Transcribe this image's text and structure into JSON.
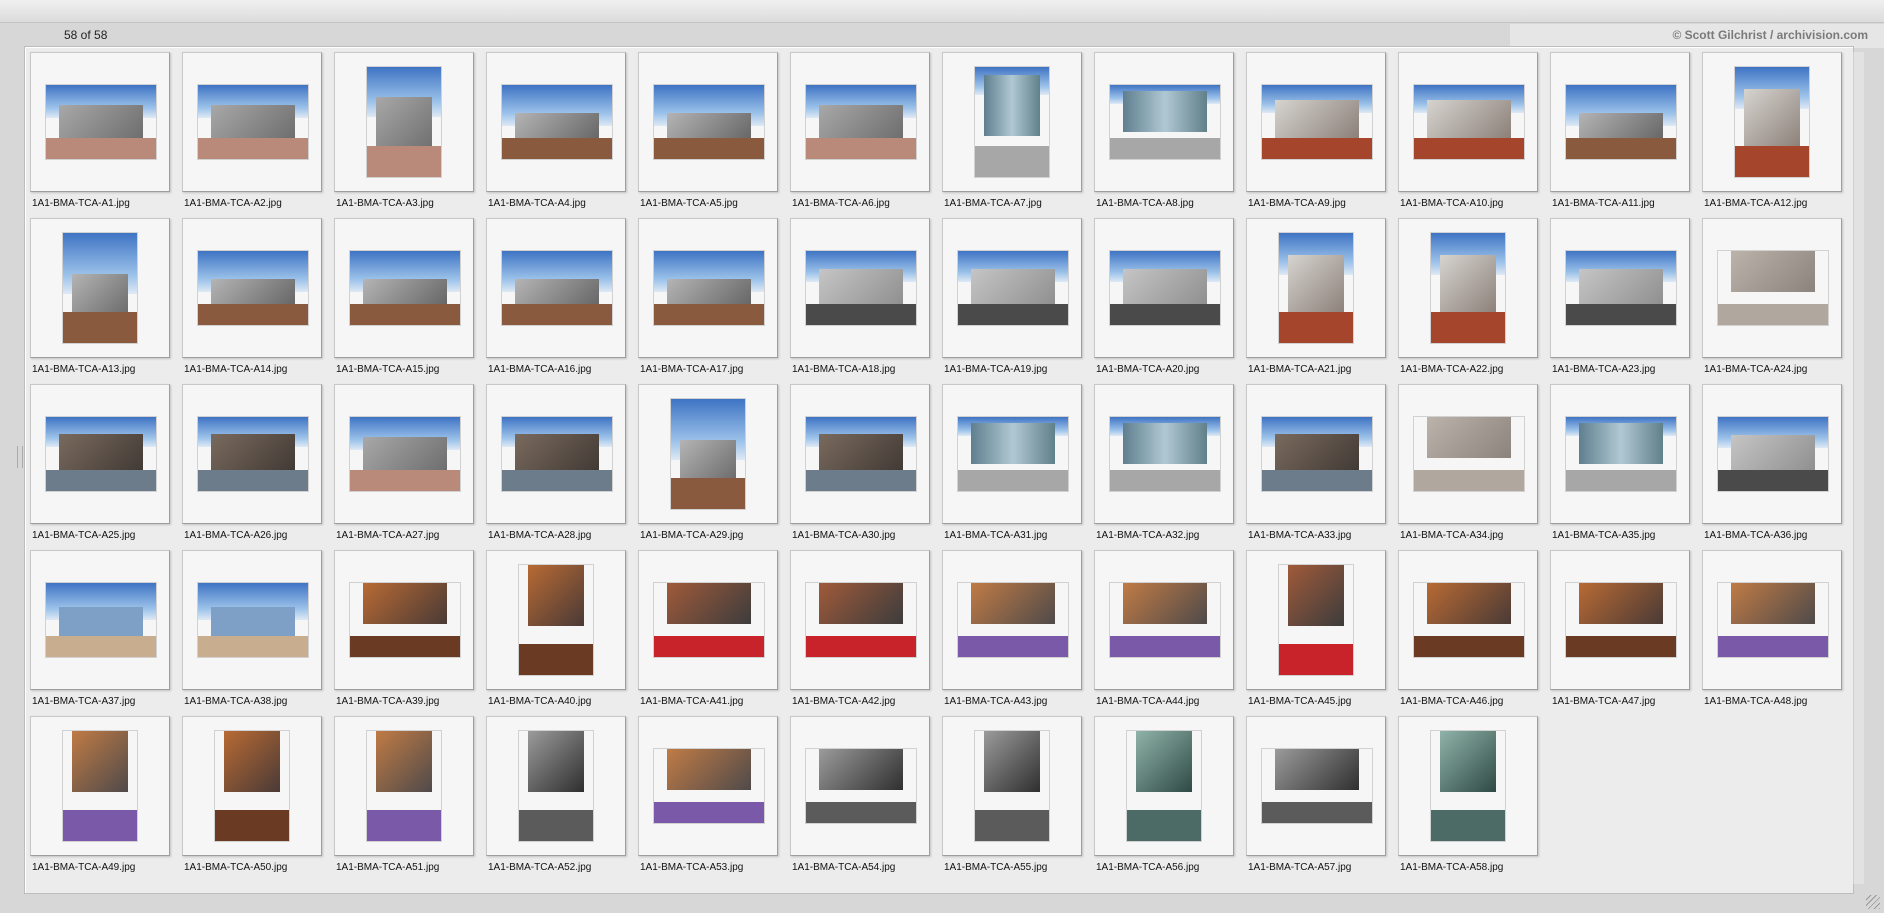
{
  "header": {
    "counter": "58 of 58",
    "copyright": "© Scott Gilchrist / archivision.com"
  },
  "thumbnails": [
    {
      "file": "1A1-BMA-TCA-A1.jpg",
      "orientation": "landscape",
      "scene": "exterior-plaza"
    },
    {
      "file": "1A1-BMA-TCA-A2.jpg",
      "orientation": "landscape",
      "scene": "exterior-plaza"
    },
    {
      "file": "1A1-BMA-TCA-A3.jpg",
      "orientation": "portrait",
      "scene": "exterior-plaza"
    },
    {
      "file": "1A1-BMA-TCA-A4.jpg",
      "orientation": "landscape",
      "scene": "exterior-sky"
    },
    {
      "file": "1A1-BMA-TCA-A5.jpg",
      "orientation": "landscape",
      "scene": "exterior-sky"
    },
    {
      "file": "1A1-BMA-TCA-A6.jpg",
      "orientation": "landscape",
      "scene": "exterior-plaza"
    },
    {
      "file": "1A1-BMA-TCA-A7.jpg",
      "orientation": "portrait",
      "scene": "glass"
    },
    {
      "file": "1A1-BMA-TCA-A8.jpg",
      "orientation": "landscape",
      "scene": "glass"
    },
    {
      "file": "1A1-BMA-TCA-A9.jpg",
      "orientation": "landscape",
      "scene": "exterior-desert"
    },
    {
      "file": "1A1-BMA-TCA-A10.jpg",
      "orientation": "landscape",
      "scene": "exterior-desert"
    },
    {
      "file": "1A1-BMA-TCA-A11.jpg",
      "orientation": "landscape",
      "scene": "exterior-sky"
    },
    {
      "file": "1A1-BMA-TCA-A12.jpg",
      "orientation": "portrait",
      "scene": "exterior-desert"
    },
    {
      "file": "1A1-BMA-TCA-A13.jpg",
      "orientation": "portrait",
      "scene": "exterior-sky"
    },
    {
      "file": "1A1-BMA-TCA-A14.jpg",
      "orientation": "landscape",
      "scene": "exterior-sky"
    },
    {
      "file": "1A1-BMA-TCA-A15.jpg",
      "orientation": "landscape",
      "scene": "exterior-sky"
    },
    {
      "file": "1A1-BMA-TCA-A16.jpg",
      "orientation": "landscape",
      "scene": "exterior-sky"
    },
    {
      "file": "1A1-BMA-TCA-A17.jpg",
      "orientation": "landscape",
      "scene": "exterior-sky"
    },
    {
      "file": "1A1-BMA-TCA-A18.jpg",
      "orientation": "landscape",
      "scene": "exterior-road"
    },
    {
      "file": "1A1-BMA-TCA-A19.jpg",
      "orientation": "landscape",
      "scene": "exterior-road"
    },
    {
      "file": "1A1-BMA-TCA-A20.jpg",
      "orientation": "landscape",
      "scene": "exterior-road"
    },
    {
      "file": "1A1-BMA-TCA-A21.jpg",
      "orientation": "portrait",
      "scene": "exterior-desert"
    },
    {
      "file": "1A1-BMA-TCA-A22.jpg",
      "orientation": "portrait",
      "scene": "exterior-desert"
    },
    {
      "file": "1A1-BMA-TCA-A23.jpg",
      "orientation": "landscape",
      "scene": "exterior-road"
    },
    {
      "file": "1A1-BMA-TCA-A24.jpg",
      "orientation": "landscape",
      "scene": "wall"
    },
    {
      "file": "1A1-BMA-TCA-A25.jpg",
      "orientation": "landscape",
      "scene": "water"
    },
    {
      "file": "1A1-BMA-TCA-A26.jpg",
      "orientation": "landscape",
      "scene": "water"
    },
    {
      "file": "1A1-BMA-TCA-A27.jpg",
      "orientation": "landscape",
      "scene": "exterior-plaza"
    },
    {
      "file": "1A1-BMA-TCA-A28.jpg",
      "orientation": "landscape",
      "scene": "water"
    },
    {
      "file": "1A1-BMA-TCA-A29.jpg",
      "orientation": "portrait",
      "scene": "exterior-sky"
    },
    {
      "file": "1A1-BMA-TCA-A30.jpg",
      "orientation": "landscape",
      "scene": "water"
    },
    {
      "file": "1A1-BMA-TCA-A31.jpg",
      "orientation": "landscape",
      "scene": "glass"
    },
    {
      "file": "1A1-BMA-TCA-A32.jpg",
      "orientation": "landscape",
      "scene": "glass"
    },
    {
      "file": "1A1-BMA-TCA-A33.jpg",
      "orientation": "landscape",
      "scene": "water"
    },
    {
      "file": "1A1-BMA-TCA-A34.jpg",
      "orientation": "landscape",
      "scene": "wall"
    },
    {
      "file": "1A1-BMA-TCA-A35.jpg",
      "orientation": "landscape",
      "scene": "glass"
    },
    {
      "file": "1A1-BMA-TCA-A36.jpg",
      "orientation": "landscape",
      "scene": "exterior-road"
    },
    {
      "file": "1A1-BMA-TCA-A37.jpg",
      "orientation": "landscape",
      "scene": "lake"
    },
    {
      "file": "1A1-BMA-TCA-A38.jpg",
      "orientation": "landscape",
      "scene": "lake"
    },
    {
      "file": "1A1-BMA-TCA-A39.jpg",
      "orientation": "landscape",
      "scene": "interior-wood"
    },
    {
      "file": "1A1-BMA-TCA-A40.jpg",
      "orientation": "portrait",
      "scene": "interior-wood"
    },
    {
      "file": "1A1-BMA-TCA-A41.jpg",
      "orientation": "landscape",
      "scene": "interior-red"
    },
    {
      "file": "1A1-BMA-TCA-A42.jpg",
      "orientation": "landscape",
      "scene": "interior-red"
    },
    {
      "file": "1A1-BMA-TCA-A43.jpg",
      "orientation": "landscape",
      "scene": "interior-purple"
    },
    {
      "file": "1A1-BMA-TCA-A44.jpg",
      "orientation": "landscape",
      "scene": "interior-purple"
    },
    {
      "file": "1A1-BMA-TCA-A45.jpg",
      "orientation": "portrait",
      "scene": "interior-red"
    },
    {
      "file": "1A1-BMA-TCA-A46.jpg",
      "orientation": "landscape",
      "scene": "interior-wood"
    },
    {
      "file": "1A1-BMA-TCA-A47.jpg",
      "orientation": "landscape",
      "scene": "interior-wood"
    },
    {
      "file": "1A1-BMA-TCA-A48.jpg",
      "orientation": "landscape",
      "scene": "interior-purple"
    },
    {
      "file": "1A1-BMA-TCA-A49.jpg",
      "orientation": "portrait",
      "scene": "interior-purple"
    },
    {
      "file": "1A1-BMA-TCA-A50.jpg",
      "orientation": "portrait",
      "scene": "interior-wood"
    },
    {
      "file": "1A1-BMA-TCA-A51.jpg",
      "orientation": "portrait",
      "scene": "interior-purple"
    },
    {
      "file": "1A1-BMA-TCA-A52.jpg",
      "orientation": "portrait",
      "scene": "interior-dark"
    },
    {
      "file": "1A1-BMA-TCA-A53.jpg",
      "orientation": "landscape",
      "scene": "interior-purple"
    },
    {
      "file": "1A1-BMA-TCA-A54.jpg",
      "orientation": "landscape",
      "scene": "interior-dark"
    },
    {
      "file": "1A1-BMA-TCA-A55.jpg",
      "orientation": "portrait",
      "scene": "interior-dark"
    },
    {
      "file": "1A1-BMA-TCA-A56.jpg",
      "orientation": "portrait",
      "scene": "interior-teal"
    },
    {
      "file": "1A1-BMA-TCA-A57.jpg",
      "orientation": "landscape",
      "scene": "interior-dark"
    },
    {
      "file": "1A1-BMA-TCA-A58.jpg",
      "orientation": "portrait",
      "scene": "interior-teal"
    }
  ]
}
